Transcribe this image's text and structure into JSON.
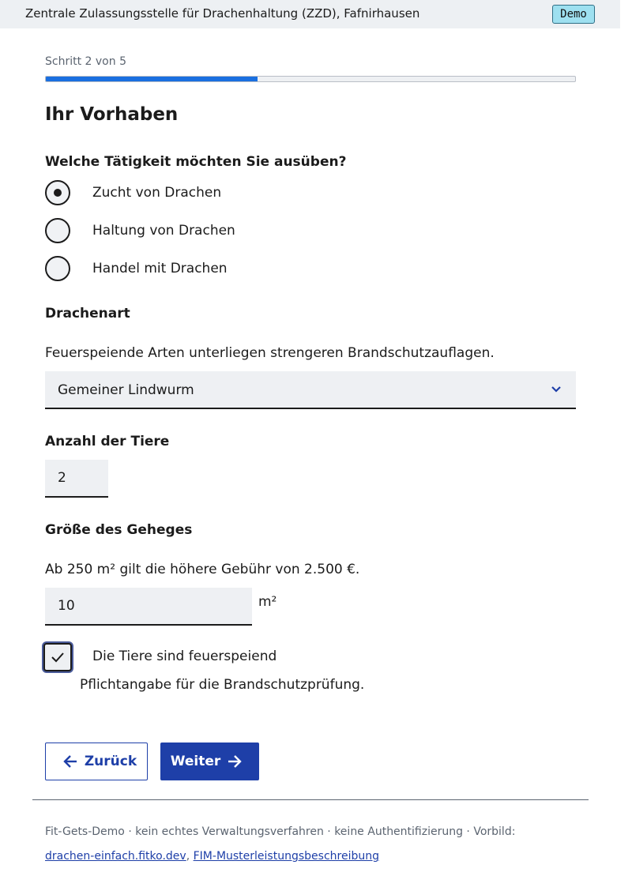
{
  "header": {
    "org": "Zentrale Zulassungsstelle für Drachenhaltung (ZZD), Fafnirhausen",
    "badge": "Demo"
  },
  "progress": {
    "label": "Schritt 2 von 5",
    "fraction": 0.4
  },
  "page_title": "Ihr Vorhaben",
  "activity": {
    "question": "Welche Tätigkeit möchten Sie ausüben?",
    "options": [
      {
        "label": "Zucht von Drachen",
        "checked": true
      },
      {
        "label": "Haltung von Drachen",
        "checked": false
      },
      {
        "label": "Handel mit Drachen",
        "checked": false
      }
    ]
  },
  "species": {
    "label": "Drachenart",
    "hint": "Feuerspeiende Arten unterliegen strengeren Brandschutzauflagen.",
    "selected": "Gemeiner Lindwurm",
    "icon": "chevron-down-icon"
  },
  "count": {
    "label": "Anzahl der Tiere",
    "value": "2"
  },
  "enclosure": {
    "label": "Größe des Geheges",
    "hint": "Ab 250 m² gilt die höhere Gebühr von 2.500 €.",
    "value": "10",
    "unit": "m²"
  },
  "fire": {
    "label": "Die Tiere sind feuerspeiend",
    "hint": "Pflichtangabe für die Brandschutzprüfung.",
    "checked": true
  },
  "buttons": {
    "back": "Zurück",
    "next": "Weiter"
  },
  "footer": {
    "text": "Fit-Gets-Demo · kein echtes Verwaltungsverfahren · keine Authentifizierung · Vorbild:",
    "link1": "drachen-einfach.fitko.dev",
    "sep": ",",
    "link2": "FIM-Musterleistungsbeschreibung"
  },
  "colors": {
    "primary": "#1e3fa8",
    "progress": "#1a6fe0",
    "badge": "#9ee0f0"
  }
}
